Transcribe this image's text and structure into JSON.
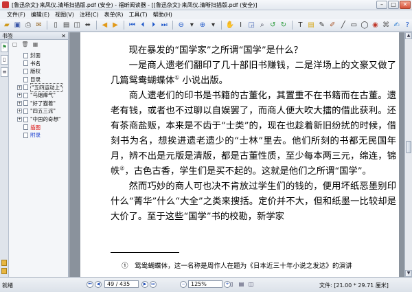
{
  "window": {
    "title": "[鲁迅杂文]·来凤仪.清晰扫描版.pdf (安全) - 福昕阅读器 - [[鲁迅杂文]·来凤仪.清晰扫描版.pdf (安全)]"
  },
  "menu": [
    "文件(F)",
    "编辑(E)",
    "视图(V)",
    "注释(C)",
    "表单(R)",
    "工具(T)",
    "帮助(H)"
  ],
  "toolbar": {
    "zoom_value": "125%"
  },
  "sidebar": {
    "title": "书签",
    "items": [
      {
        "label": "封面",
        "expand": false,
        "style": "normal"
      },
      {
        "label": "书名",
        "expand": false,
        "style": "normal"
      },
      {
        "label": "版权",
        "expand": false,
        "style": "normal"
      },
      {
        "label": "目录",
        "expand": false,
        "style": "normal"
      },
      {
        "label": "\"五四运动上\"",
        "expand": true,
        "style": "boxed"
      },
      {
        "label": "\"乌烟瘴气\"",
        "expand": true,
        "style": "normal"
      },
      {
        "label": "\"好了猫着\"",
        "expand": true,
        "style": "normal"
      },
      {
        "label": "\"四五三派\"",
        "expand": true,
        "style": "normal"
      },
      {
        "label": "\"中国的奇想\"",
        "expand": true,
        "style": "normal"
      },
      {
        "label": "插图",
        "expand": false,
        "style": "red"
      },
      {
        "label": "附录",
        "expand": false,
        "style": "blue"
      }
    ]
  },
  "document": {
    "heading": "现在暴发的“国学家”之所谓“国学”是什么？",
    "para1_a": "一是商人遗老们翻印了几十部旧书赚钱，二是洋场上的文豪又做了几篇鸳鸯蝴蝶体",
    "para1_note": "①",
    "para1_b": "小说出版。",
    "para2": "商人遗老们的印书是书籍的古董化，其置重不在书籍而在古董。遗老有钱，或者也不过聊以自娱罢了，而商人便大吹大擂的借此获利。还有茶商盐贩，本来是不齿于“士类”的，现在也趁着新旧纷扰的时候，借刻书为名，想挨进遗老遗少的“士林”里去。他们所刻的书都无民国年月，辨不出是元版是清版，都是古董性质，至少每本两三元，绵连，锦帙",
    "para2_note": "②",
    "para2_b": "，古色古香，学生们是买不起的。这就是他们之所谓“国学”。",
    "para3": "然而巧妙的商人可也决不肯放过学生们的钱的，便用坏纸恶墨别印什么“菁华”什么“大全”之类来搜括。定价并不大，但和纸墨一比较却是大价了。至于这些“国学”书的校勘，新学家",
    "footnote": "①　鸳鸯蝴蝶体，这一名称是周作人在题为《日本近三十年小说之发达》的演讲"
  },
  "status": {
    "left_text": "就绪",
    "page_current": "49 / 435",
    "zoom": "125%",
    "doc_size": "文件: [21.00 * 29.71 厘米]"
  }
}
